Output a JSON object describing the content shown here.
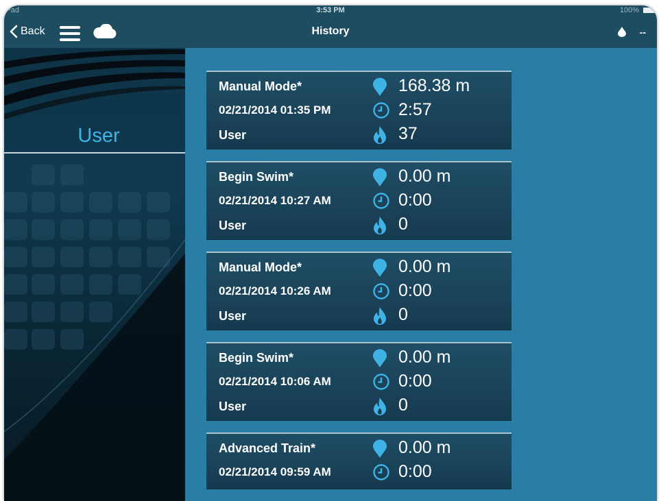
{
  "status_bar": {
    "device": "iPad",
    "time": "3:53 PM",
    "battery": "100%"
  },
  "nav": {
    "back_label": "Back",
    "title": "History",
    "value": "--"
  },
  "sidebar": {
    "user_label": "User"
  },
  "colors": {
    "accent": "#3fb3e6",
    "nav_bg": "#1e4c60",
    "main_bg": "#2a7ea5",
    "card_bg": "#1b455b"
  },
  "icons": [
    "chevron-left-icon",
    "hamburger-menu-icon",
    "cloud-icon",
    "droplet-icon",
    "map-pin-icon",
    "clock-icon",
    "flame-icon"
  ],
  "history": [
    {
      "mode": "Manual Mode*",
      "datetime": "02/21/2014 01:35 PM",
      "user": "User",
      "distance": "168.38 m",
      "duration": "2:57",
      "calories": "37"
    },
    {
      "mode": "Begin Swim*",
      "datetime": "02/21/2014 10:27 AM",
      "user": "User",
      "distance": "0.00 m",
      "duration": "0:00",
      "calories": "0"
    },
    {
      "mode": "Manual Mode*",
      "datetime": "02/21/2014 10:26 AM",
      "user": "User",
      "distance": "0.00 m",
      "duration": "0:00",
      "calories": "0"
    },
    {
      "mode": "Begin Swim*",
      "datetime": "02/21/2014 10:06 AM",
      "user": "User",
      "distance": "0.00 m",
      "duration": "0:00",
      "calories": "0"
    },
    {
      "mode": "Advanced Train*",
      "datetime": "02/21/2014 09:59 AM",
      "distance": "0.00 m",
      "duration": "0:00"
    }
  ]
}
